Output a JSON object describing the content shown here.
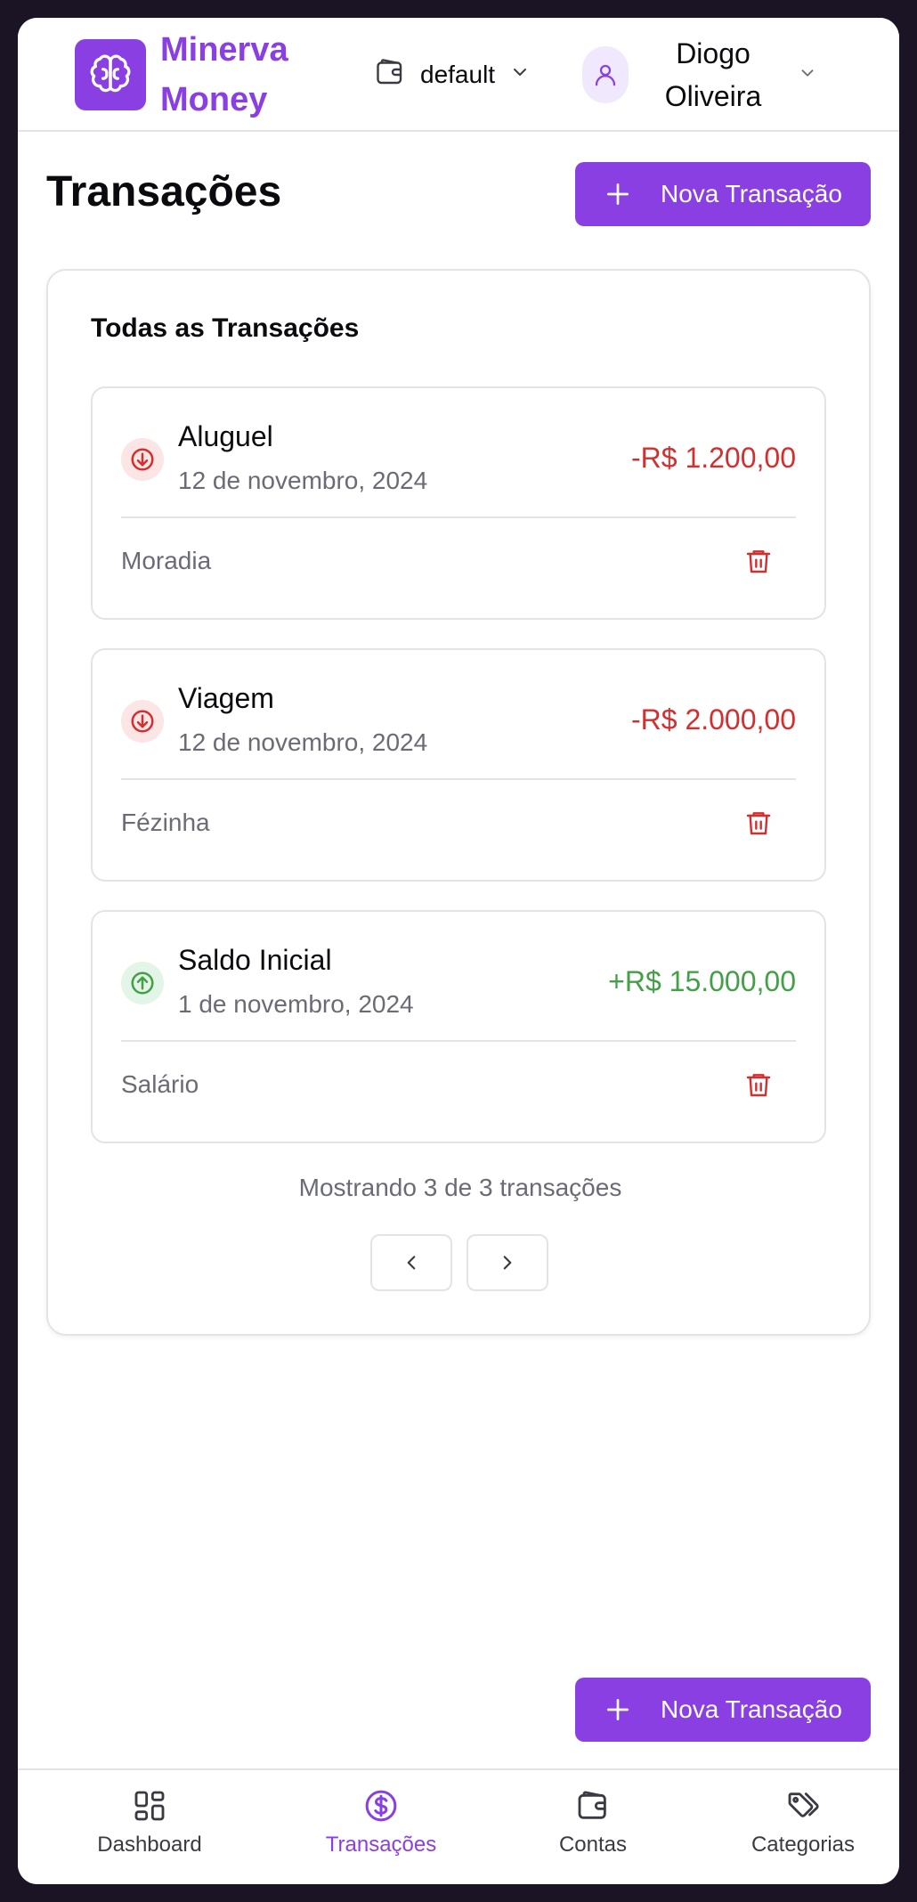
{
  "brand": {
    "line1": "Minerva",
    "line2": "Money"
  },
  "wallet": {
    "selected": "default"
  },
  "user": {
    "first_name": "Diogo",
    "last_name": "Oliveira"
  },
  "page": {
    "title": "Transações",
    "new_button_label": "Nova Transação"
  },
  "card": {
    "title": "Todas as Transações",
    "transactions": [
      {
        "name": "Aluguel",
        "date": "12 de novembro, 2024",
        "amount": "-R$ 1.200,00",
        "category": "Moradia",
        "direction": "out"
      },
      {
        "name": "Viagem",
        "date": "12 de novembro, 2024",
        "amount": "-R$ 2.000,00",
        "category": "Fézinha",
        "direction": "out"
      },
      {
        "name": "Saldo Inicial",
        "date": "1 de novembro, 2024",
        "amount": "+R$ 15.000,00",
        "category": "Salário",
        "direction": "in"
      }
    ],
    "showing_text": "Mostrando 3 de 3 transações"
  },
  "fab": {
    "label": "Nova Transação"
  },
  "bottom_nav": {
    "items": [
      {
        "label": "Dashboard",
        "icon": "grid-icon"
      },
      {
        "label": "Transações",
        "icon": "dollar-circle-icon",
        "active": true
      },
      {
        "label": "Contas",
        "icon": "wallet-icon"
      },
      {
        "label": "Categorias",
        "icon": "tags-icon"
      }
    ]
  },
  "colors": {
    "accent": "#8a3fe3",
    "negative": "#d32f2f",
    "positive": "#43a047",
    "muted_text": "#6b6b75"
  }
}
